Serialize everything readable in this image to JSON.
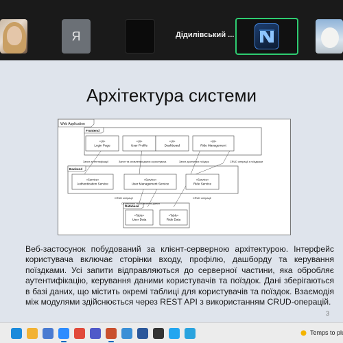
{
  "meeting": {
    "participants": [
      {
        "kind": "video",
        "name": ""
      },
      {
        "kind": "initial",
        "initial": "Я"
      },
      {
        "kind": "camera-off"
      },
      {
        "kind": "name",
        "name": "Дідилівський ..."
      },
      {
        "kind": "logo",
        "active_speaker": true
      },
      {
        "kind": "photo"
      }
    ]
  },
  "slide": {
    "title": "Архітектура системи",
    "page_number": "3",
    "body": "Веб-застосунок побудований за клієнт-серверною архітектурою. Інтерфейс користувача включає сторінки входу, профілю, дашборду та керування поїздками. Усі запити відправляються до серверної частини, яка обробляє аутентифікацію, керування даними користувачів та поїздок. Дані зберігаються в базі даних, що містить окремі таблиці для користувачів та поїздок. Взаємодія між модулями здійснюється через REST API з використанням CRUD-операцій."
  },
  "diagram": {
    "frame_label": "Web Application",
    "frontend": {
      "label": "Frontend",
      "components": [
        {
          "stereotype": "«UI»",
          "name": "Login Page"
        },
        {
          "stereotype": "«UI»",
          "name": "User Profile"
        },
        {
          "stereotype": "«UI»",
          "name": "Dashboard"
        },
        {
          "stereotype": "«UI»",
          "name": "Ride Management"
        }
      ]
    },
    "backend": {
      "label": "Backend",
      "components": [
        {
          "stereotype": "«Service»",
          "name": "Authentication Service"
        },
        {
          "stereotype": "«Service»",
          "name": "User Management Service"
        },
        {
          "stereotype": "«Service»",
          "name": "Ride Service"
        }
      ]
    },
    "database": {
      "label": "Database",
      "components": [
        {
          "stereotype": "«Table»",
          "name": "User Data"
        },
        {
          "stereotype": "«Table»",
          "name": "Ride Data"
        }
      ]
    },
    "edges": [
      "Запит аутентифікації",
      "Запит та оновлення даних користувача",
      "Запит доступних поїздок",
      "CRUD операції з поїздками",
      "CRUD операції",
      "Отримання та оновлення даних",
      "CRUD операції"
    ]
  },
  "taskbar": {
    "temperature_text": "Temps to plu",
    "icons": [
      {
        "name": "edge-icon",
        "color": "#1b8adb"
      },
      {
        "name": "file-explorer-icon",
        "color": "#f2b233"
      },
      {
        "name": "store-icon",
        "color": "#4a7bd1"
      },
      {
        "name": "zoom-icon",
        "color": "#2d8cff"
      },
      {
        "name": "chrome-icon",
        "color": "#e14a3b"
      },
      {
        "name": "teams-icon",
        "color": "#5059c9"
      },
      {
        "name": "powerpoint-icon",
        "color": "#c94f2d"
      },
      {
        "name": "photos-icon",
        "color": "#3b8fd6"
      },
      {
        "name": "word-icon",
        "color": "#2b579a"
      },
      {
        "name": "terminal-icon",
        "color": "#333333"
      },
      {
        "name": "vscode-icon",
        "color": "#23a6f0"
      },
      {
        "name": "telegram-icon",
        "color": "#2aa3de"
      }
    ]
  }
}
